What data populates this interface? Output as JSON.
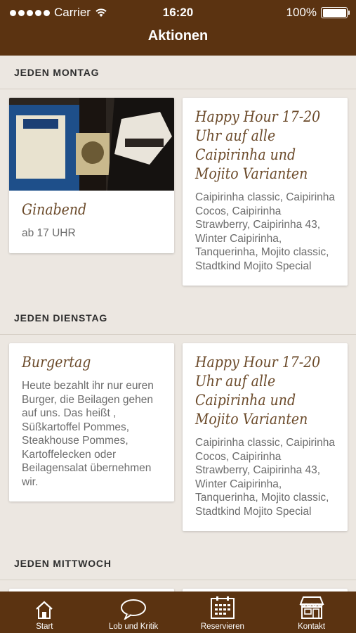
{
  "status_bar": {
    "carrier": "Carrier",
    "time": "16:20",
    "battery": "100%"
  },
  "nav": {
    "title": "Aktionen"
  },
  "sections": [
    {
      "heading": "JEDEN MONTAG",
      "left_card": {
        "image": "gin-bottles-photo",
        "title": "Ginabend",
        "text": "ab 17 UHR"
      },
      "right_card": {
        "title": "Happy Hour 17-20 Uhr auf alle Caipirinha und Mojito Varianten",
        "text": "Caipirinha classic, Caipirinha Cocos, Caipirinha Strawberry, Caipirinha 43, Winter Caipirinha, Tanquerinha, Mojito classic, Stadtkind Mojito Special"
      }
    },
    {
      "heading": "JEDEN DIENSTAG",
      "left_card": {
        "title": "Burgertag",
        "text": "Heute bezahlt ihr nur euren Burger, die Beilagen gehen auf uns. Das heißt , Süßkartoffel Pommes, Steakhouse Pommes, Kartoffelecken oder Beilagensalat übernehmen wir."
      },
      "right_card": {
        "title": "Happy Hour 17-20 Uhr auf alle Caipirinha und Mojito Varianten",
        "text": "Caipirinha classic, Caipirinha Cocos, Caipirinha Strawberry, Caipirinha 43, Winter Caipirinha, Tanquerinha, Mojito classic, Stadtkind Mojito Special"
      }
    },
    {
      "heading": "JEDEN MITTWOCH"
    }
  ],
  "tabbar": [
    {
      "label": "Start",
      "icon": "home-icon"
    },
    {
      "label": "Lob und Kritik",
      "icon": "speech-bubble-icon"
    },
    {
      "label": "Reservieren",
      "icon": "calendar-icon"
    },
    {
      "label": "Kontakt",
      "icon": "storefront-icon"
    }
  ],
  "colors": {
    "brand_brown": "#5b3311",
    "background": "#ece7e1",
    "title_brown": "#6b4a2a"
  }
}
